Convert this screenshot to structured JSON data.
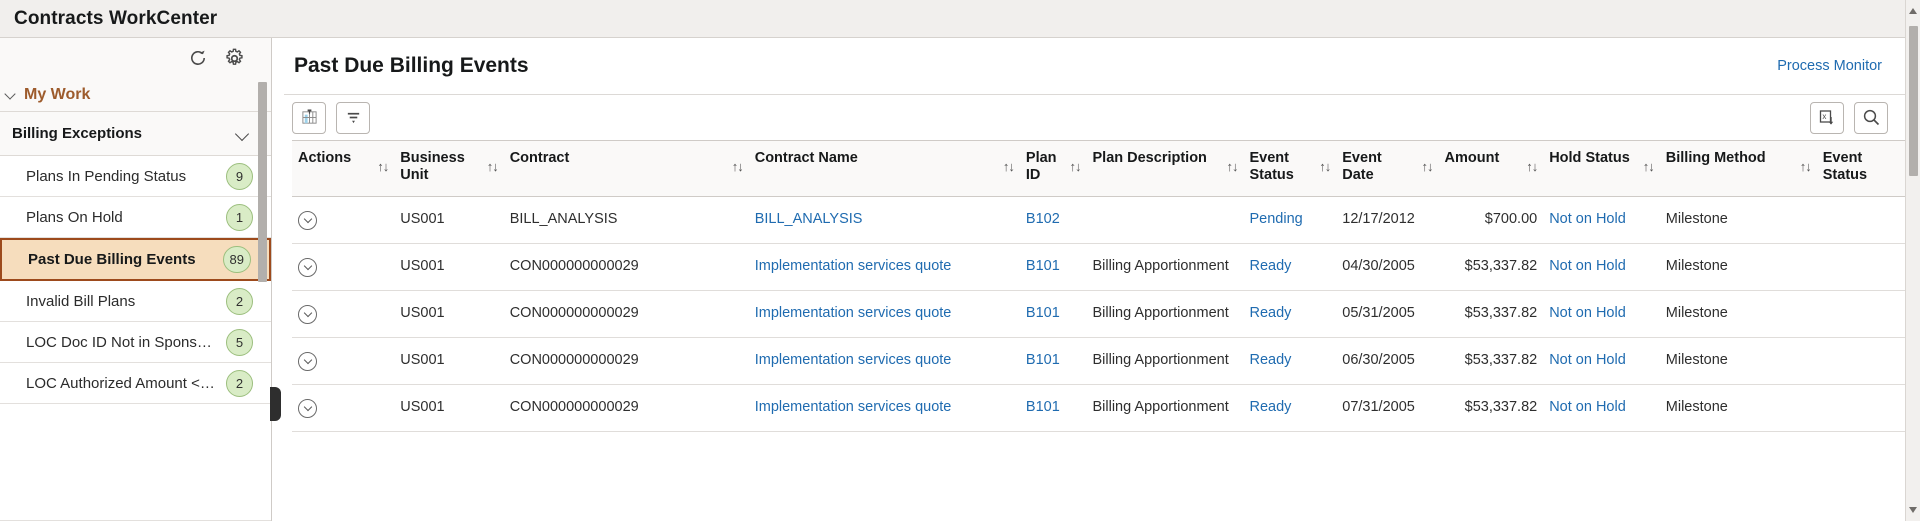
{
  "app": {
    "title": "Contracts WorkCenter"
  },
  "sidebar": {
    "refresh_icon": "refresh-icon",
    "settings_icon": "gear-icon",
    "my_work_label": "My Work",
    "group_label": "Billing Exceptions",
    "items": [
      {
        "label": "Plans In Pending Status",
        "badge": "9",
        "selected": false
      },
      {
        "label": "Plans On Hold",
        "badge": "1",
        "selected": false
      },
      {
        "label": "Past Due Billing Events",
        "badge": "89",
        "selected": true
      },
      {
        "label": "Invalid Bill Plans",
        "badge": "2",
        "selected": false
      },
      {
        "label": "LOC Doc ID Not in Sponsor …",
        "badge": "5",
        "selected": false
      },
      {
        "label": "LOC Authorized Amount <> …",
        "badge": "2",
        "selected": false
      }
    ]
  },
  "main": {
    "page_title": "Past Due Billing Events",
    "process_monitor_label": "Process Monitor",
    "toolbar": {
      "chart_label": "chart-icon",
      "filter_label": "filter-icon",
      "excel_label": "excel-download-icon",
      "search_label": "search-icon"
    }
  },
  "table": {
    "sort_glyph": "↑↓",
    "columns": [
      "Actions",
      "Business Unit",
      "Contract",
      "Contract Name",
      "Plan ID",
      "Plan Description",
      "Event Status",
      "Event Date",
      "Amount",
      "Hold Status",
      "Billing Method",
      "Event Status"
    ],
    "rows": [
      {
        "business_unit": "US001",
        "contract": "BILL_ANALYSIS",
        "contract_name": "BILL_ANALYSIS",
        "plan_id": "B102",
        "plan_description": "",
        "event_status": "Pending",
        "event_date": "12/17/2012",
        "amount": "$700.00",
        "hold_status": "Not on Hold",
        "billing_method": "Milestone"
      },
      {
        "business_unit": "US001",
        "contract": "CON000000000029",
        "contract_name": "Implementation services quote",
        "plan_id": "B101",
        "plan_description": "Billing Apportionment",
        "event_status": "Ready",
        "event_date": "04/30/2005",
        "amount": "$53,337.82",
        "hold_status": "Not on Hold",
        "billing_method": "Milestone"
      },
      {
        "business_unit": "US001",
        "contract": "CON000000000029",
        "contract_name": "Implementation services quote",
        "plan_id": "B101",
        "plan_description": "Billing Apportionment",
        "event_status": "Ready",
        "event_date": "05/31/2005",
        "amount": "$53,337.82",
        "hold_status": "Not on Hold",
        "billing_method": "Milestone"
      },
      {
        "business_unit": "US001",
        "contract": "CON000000000029",
        "contract_name": "Implementation services quote",
        "plan_id": "B101",
        "plan_description": "Billing Apportionment",
        "event_status": "Ready",
        "event_date": "06/30/2005",
        "amount": "$53,337.82",
        "hold_status": "Not on Hold",
        "billing_method": "Milestone"
      },
      {
        "business_unit": "US001",
        "contract": "CON000000000029",
        "contract_name": "Implementation services quote",
        "plan_id": "B101",
        "plan_description": "Billing Apportionment",
        "event_status": "Ready",
        "event_date": "07/31/2005",
        "amount": "$53,337.82",
        "hold_status": "Not on Hold",
        "billing_method": "Milestone"
      }
    ]
  },
  "colors": {
    "accent_brown": "#9d5b2c",
    "selected_bg": "#f6ddbd",
    "selected_border": "#9d4a1c",
    "link_blue": "#1f6bb0",
    "badge_green": "#d9ecc6"
  }
}
